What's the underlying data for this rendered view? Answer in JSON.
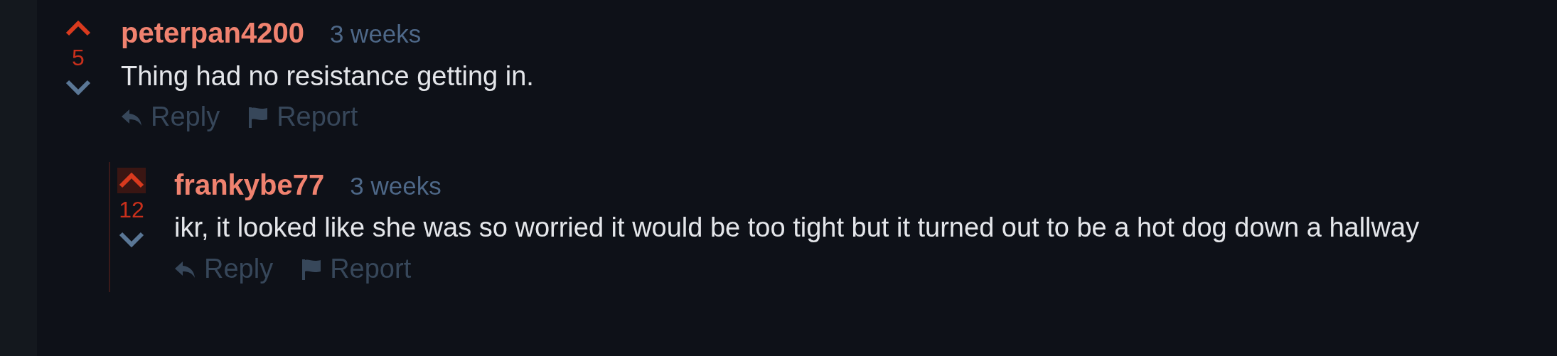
{
  "comments": [
    {
      "author": "peterpan4200",
      "time": "3 weeks",
      "score": "5",
      "upvoted": true,
      "highlighted": false,
      "body": "Thing had no resistance getting in.",
      "actions": [
        {
          "kind": "reply",
          "label": "Reply"
        },
        {
          "kind": "report",
          "label": "Report"
        }
      ],
      "children": [
        {
          "author": "frankybe77",
          "time": "3 weeks",
          "score": "12",
          "upvoted": true,
          "highlighted": true,
          "body": "ikr, it looked like she was so worried it would be too tight but it turned out to be a hot dog down a hallway",
          "actions": [
            {
              "kind": "reply",
              "label": "Reply"
            },
            {
              "kind": "report",
              "label": "Report"
            }
          ]
        }
      ]
    }
  ]
}
